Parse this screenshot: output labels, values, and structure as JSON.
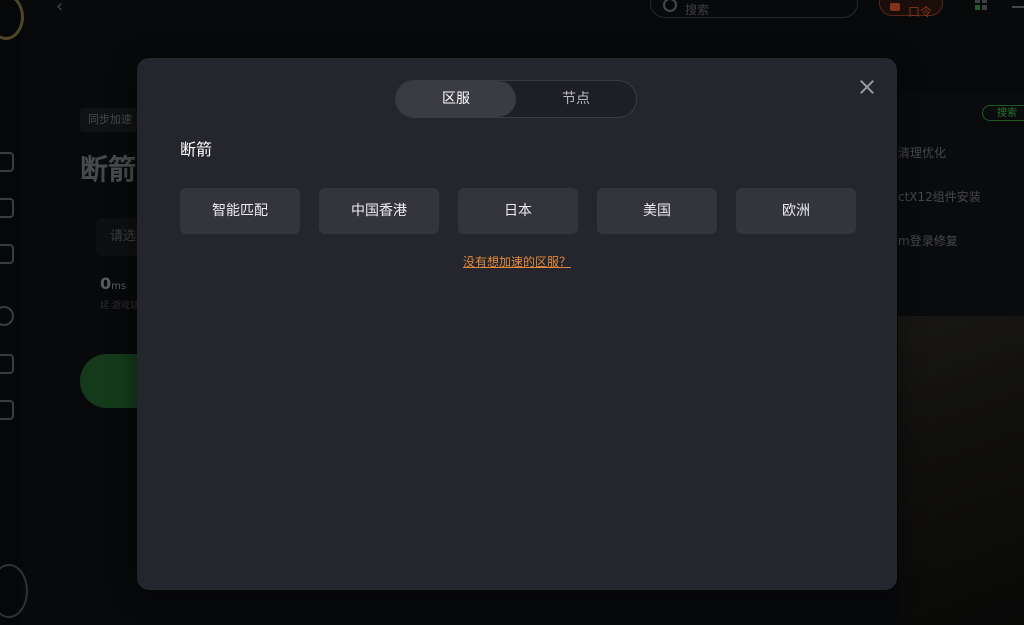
{
  "background": {
    "search_placeholder": "搜索",
    "code_button": "口令",
    "sync_tag": "同步加速",
    "game_title": "断箭",
    "select_placeholder": "请选",
    "ping_value": "0",
    "ping_unit": "ms",
    "ping_caption": "延 游戏延",
    "tool_badge": "搜索",
    "tools": [
      "清理优化",
      "ctX12组件安装",
      "m登录修复"
    ]
  },
  "modal": {
    "tabs": [
      {
        "label": "区服",
        "active": true
      },
      {
        "label": "节点",
        "active": false
      }
    ],
    "game_name": "断箭",
    "regions": [
      "智能匹配",
      "中国香港",
      "日本",
      "美国",
      "欧洲"
    ],
    "missing_link": "没有想加速的区服？"
  },
  "colors": {
    "modal_bg": "#25262d",
    "region_button_bg": "#33343c",
    "active_tab_bg": "#3a3b43",
    "link_color": "#e0893c"
  },
  "icons": [
    "close-icon",
    "search-icon",
    "back-arrow-icon",
    "grid-icon",
    "minimize-icon"
  ]
}
